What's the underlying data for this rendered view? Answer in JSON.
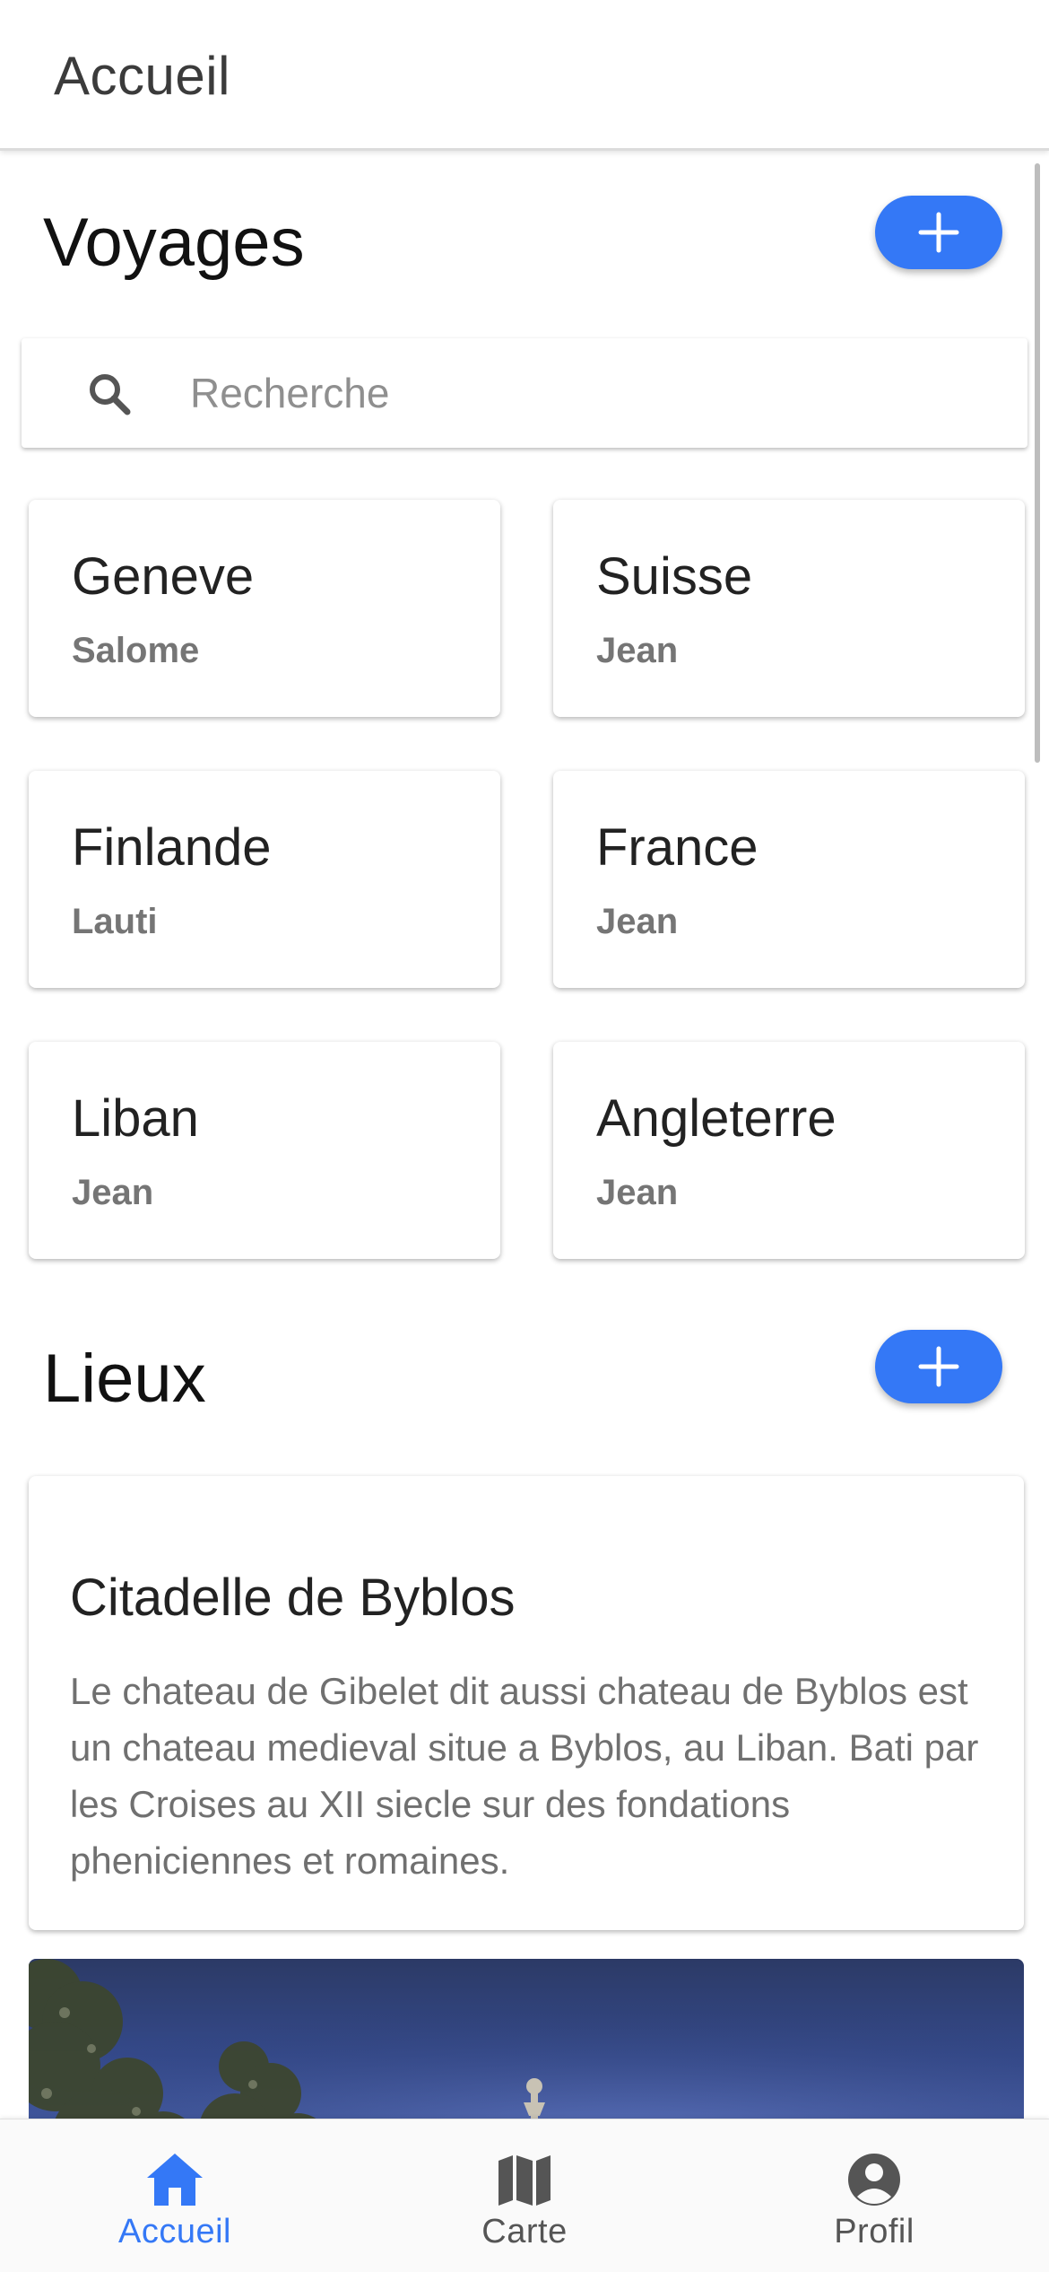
{
  "topbar": {
    "title": "Accueil"
  },
  "voyages": {
    "title": "Voyages",
    "search_placeholder": "Recherche",
    "items": [
      {
        "title": "Geneve",
        "owner": "Salome"
      },
      {
        "title": "Suisse",
        "owner": "Jean"
      },
      {
        "title": "Finlande",
        "owner": "Lauti"
      },
      {
        "title": "France",
        "owner": "Jean"
      },
      {
        "title": "Liban",
        "owner": "Jean"
      },
      {
        "title": "Angleterre",
        "owner": "Jean"
      }
    ]
  },
  "lieux": {
    "title": "Lieux",
    "items": [
      {
        "title": "Citadelle de Byblos",
        "description": "Le chateau de Gibelet dit aussi chateau de Byblos est un chateau medieval situe a Byblos, au Liban. Bati par les Croises au XII siecle sur des fondations pheniciennes et romaines."
      }
    ]
  },
  "bottom_nav": {
    "items": [
      {
        "label": "Accueil",
        "icon": "home-icon",
        "active": true
      },
      {
        "label": "Carte",
        "icon": "map-icon",
        "active": false
      },
      {
        "label": "Profil",
        "icon": "account-circle-icon",
        "active": false
      }
    ]
  },
  "colors": {
    "accent": "#3478f6",
    "title_text": "#3b3b3b",
    "muted_text": "#757575"
  }
}
